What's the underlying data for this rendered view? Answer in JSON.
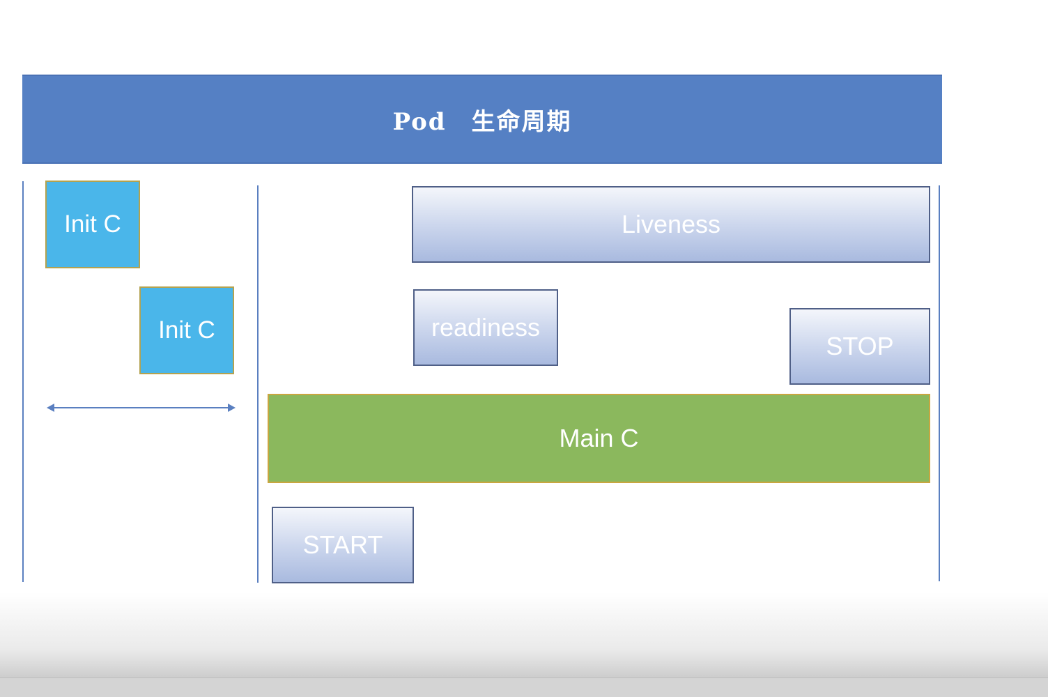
{
  "header": {
    "title": "Pod　生命周期",
    "background": "#5580c4"
  },
  "init_containers": [
    {
      "label": "Init C"
    },
    {
      "label": "Init C"
    }
  ],
  "probes": {
    "liveness": "Liveness",
    "readiness": "readiness"
  },
  "hooks": {
    "start": "START",
    "stop": "STOP"
  },
  "main_container": {
    "label": "Main C",
    "background": "#8bb85d"
  },
  "colors": {
    "init": "#4ab6ea",
    "line": "#5a7fc0"
  }
}
